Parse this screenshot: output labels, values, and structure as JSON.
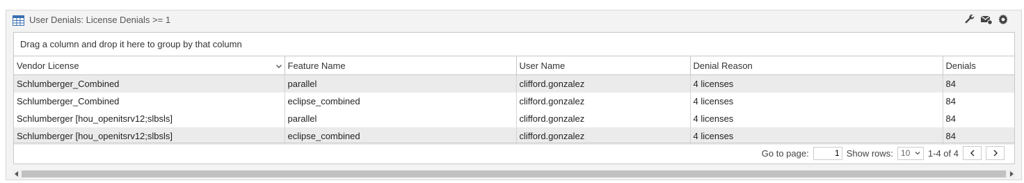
{
  "widget": {
    "title": "User Denials: License Denials >= 1"
  },
  "tools": [
    {
      "icon": "wrench-icon"
    },
    {
      "icon": "email-settings-icon"
    },
    {
      "icon": "gear-icon"
    }
  ],
  "grid": {
    "group_hint": "Drag a column and drop it here to group by that column",
    "columns": [
      "Vendor License",
      "Feature Name",
      "User Name",
      "Denial Reason",
      "Denials"
    ],
    "rows": [
      [
        "Schlumberger_Combined",
        "parallel",
        "clifford.gonzalez",
        "4 licenses",
        "84"
      ],
      [
        "Schlumberger_Combined",
        "eclipse_combined",
        "clifford.gonzalez",
        "4 licenses",
        "84"
      ],
      [
        "Schlumberger [hou_openitsrv12;slbsls]",
        "parallel",
        "clifford.gonzalez",
        "4 licenses",
        "84"
      ],
      [
        "Schlumberger [hou_openitsrv12;slbsls]",
        "eclipse_combined",
        "clifford.gonzalez",
        "4 licenses",
        "84"
      ]
    ]
  },
  "pager": {
    "go_to_label": "Go to page:",
    "page_value": "1",
    "show_rows_label": "Show rows:",
    "rows_value": "10",
    "range_text": "1-4 of 4"
  },
  "colors": {
    "alt_row": "#ebebeb",
    "border": "#c8c8c8"
  }
}
